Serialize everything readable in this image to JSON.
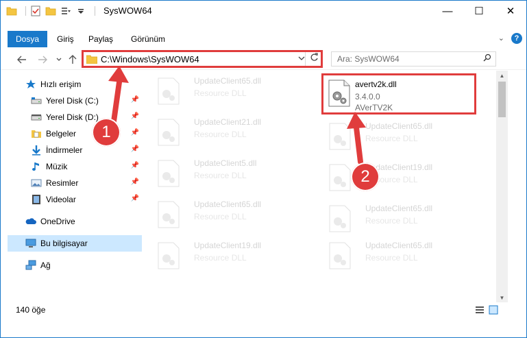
{
  "window": {
    "title": "SysWOW64",
    "minimize_glyph": "—",
    "maximize_glyph": "☐",
    "close_glyph": "✕"
  },
  "ribbon": {
    "tabs": [
      "Dosya",
      "Giriş",
      "Paylaş",
      "Görünüm"
    ],
    "help_glyph": "?",
    "collapse_glyph": "⌄"
  },
  "nav": {
    "address": "C:\\Windows\\SysWOW64",
    "search_placeholder": "Ara: SysWOW64"
  },
  "sidebar": {
    "quick_access": "Hızlı erişim",
    "pinned": [
      {
        "label": "Yerel Disk (C:)",
        "icon": "drive-icon"
      },
      {
        "label": "Yerel Disk (D:)",
        "icon": "drive-icon"
      },
      {
        "label": "Belgeler",
        "icon": "documents-icon"
      },
      {
        "label": "İndirmeler",
        "icon": "downloads-icon"
      },
      {
        "label": "Müzik",
        "icon": "music-icon"
      },
      {
        "label": "Resimler",
        "icon": "pictures-icon"
      },
      {
        "label": "Videolar",
        "icon": "videos-icon"
      }
    ],
    "onedrive": "OneDrive",
    "this_pc": "Bu bilgisayar",
    "network": "Ağ"
  },
  "files": {
    "highlighted": {
      "name": "avertv2k.dll",
      "version": "3.4.0.0",
      "company": "AVerTV2K"
    },
    "left_column": [
      {
        "name": "UpdateClient65.dll",
        "desc": "Resource DLL"
      },
      {
        "name": "UpdateClient21.dll",
        "desc": "Resource DLL"
      },
      {
        "name": "UpdateClient5.dll",
        "desc": "Resource DLL"
      },
      {
        "name": "UpdateClient65.dll",
        "desc": "Resource DLL"
      },
      {
        "name": "UpdateClient19.dll",
        "desc": "Resource DLL"
      }
    ],
    "right_column": [
      {
        "name": "UpdateClient65.dll",
        "desc": "Resource DLL"
      },
      {
        "name": "UpdateClient19.dll",
        "desc": "Resource DLL"
      },
      {
        "name": "UpdateClient65.dll",
        "desc": "Resource DLL"
      },
      {
        "name": "UpdateClient65.dll",
        "desc": "Resource DLL"
      }
    ]
  },
  "status": {
    "item_count": "140 öğe"
  },
  "callouts": [
    "1",
    "2"
  ],
  "colors": {
    "accent": "#1979ca",
    "highlight": "#e03c3c",
    "selection": "#cce8ff"
  }
}
